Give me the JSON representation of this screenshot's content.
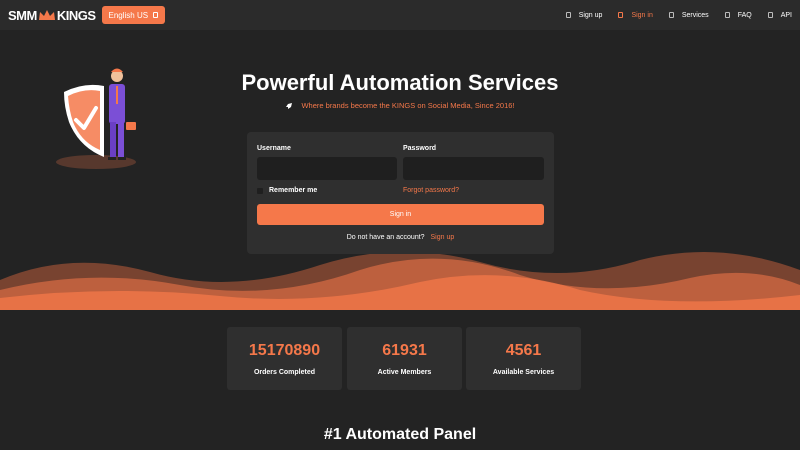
{
  "navbar": {
    "logo_left": "SMM",
    "logo_right": "KINGS",
    "language": "English US",
    "links": [
      {
        "label": "Sign up",
        "active": false
      },
      {
        "label": "Sign in",
        "active": true
      },
      {
        "label": "Services",
        "active": false
      },
      {
        "label": "FAQ",
        "active": false
      },
      {
        "label": "API",
        "active": false
      }
    ]
  },
  "hero": {
    "title": "Powerful Automation Services",
    "subtitle": "Where brands become the KINGS on Social Media, Since 2016!"
  },
  "login": {
    "username_label": "Username",
    "password_label": "Password",
    "username_value": "",
    "password_value": "",
    "remember_label": "Remember me",
    "forgot_label": "Forgot password?",
    "signin_label": "Sign in",
    "no_account_text": "Do not have an account?",
    "signup_link": "Sign up"
  },
  "stats": [
    {
      "value": "15170890",
      "label": "Orders Completed"
    },
    {
      "value": "61931",
      "label": "Active Members"
    },
    {
      "value": "4561",
      "label": "Available Services"
    }
  ],
  "section": {
    "title": "#1 Automated Panel"
  },
  "colors": {
    "accent": "#f5784a",
    "background": "#232323",
    "card": "#2f2f2f",
    "input": "#1f1f1f",
    "illustration_suit": "#7b4fd6"
  },
  "icons": {
    "language": "flag-icon",
    "nav": "nav-item-icon",
    "subtitle": "rocket-icon",
    "remember": "checkbox-icon"
  }
}
